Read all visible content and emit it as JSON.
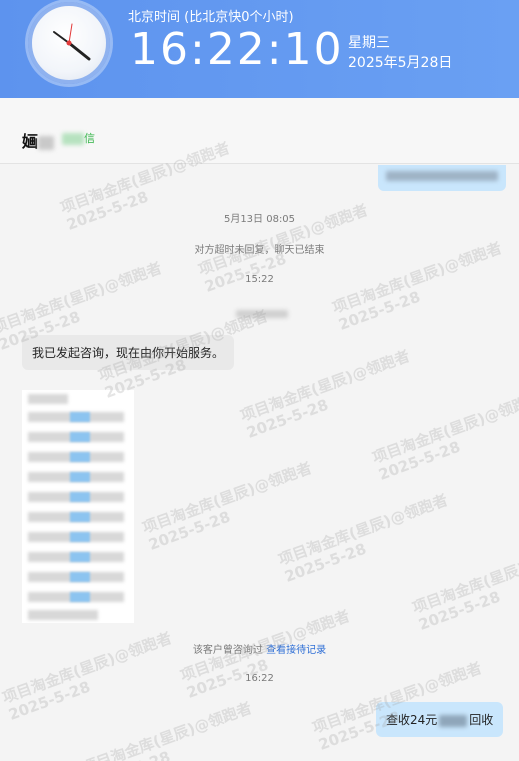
{
  "clock": {
    "timezone_label": "北京时间 (比北京快0个小时)",
    "time": "16:22:10",
    "weekday": "星期三",
    "date": "2025年5月28日"
  },
  "contact": {
    "name_visible": "婳",
    "channel_suffix": "信"
  },
  "chat": {
    "system_date": "5月13日 08:05",
    "system_notice": "对方超时未回复，聊天已结束",
    "time_1": "15:22",
    "msg_in_1": "我已发起咨询，现在由你开始服务。",
    "history_prefix": "该客户曾咨询过",
    "history_link": "查看接待记录",
    "time_2": "16:22",
    "msg_out_prefix": "查收24元",
    "msg_out_suffix": "回收"
  },
  "watermark": {
    "line1": "项目淘金库(星辰)@领跑者",
    "line2": "2025-5-28"
  },
  "colors": {
    "header_blue": "#5d93ee",
    "out_bubble": "#c9e6fc",
    "in_bubble": "#e9e9e9",
    "link": "#2f6fd6",
    "channel_green": "#2fb344"
  }
}
